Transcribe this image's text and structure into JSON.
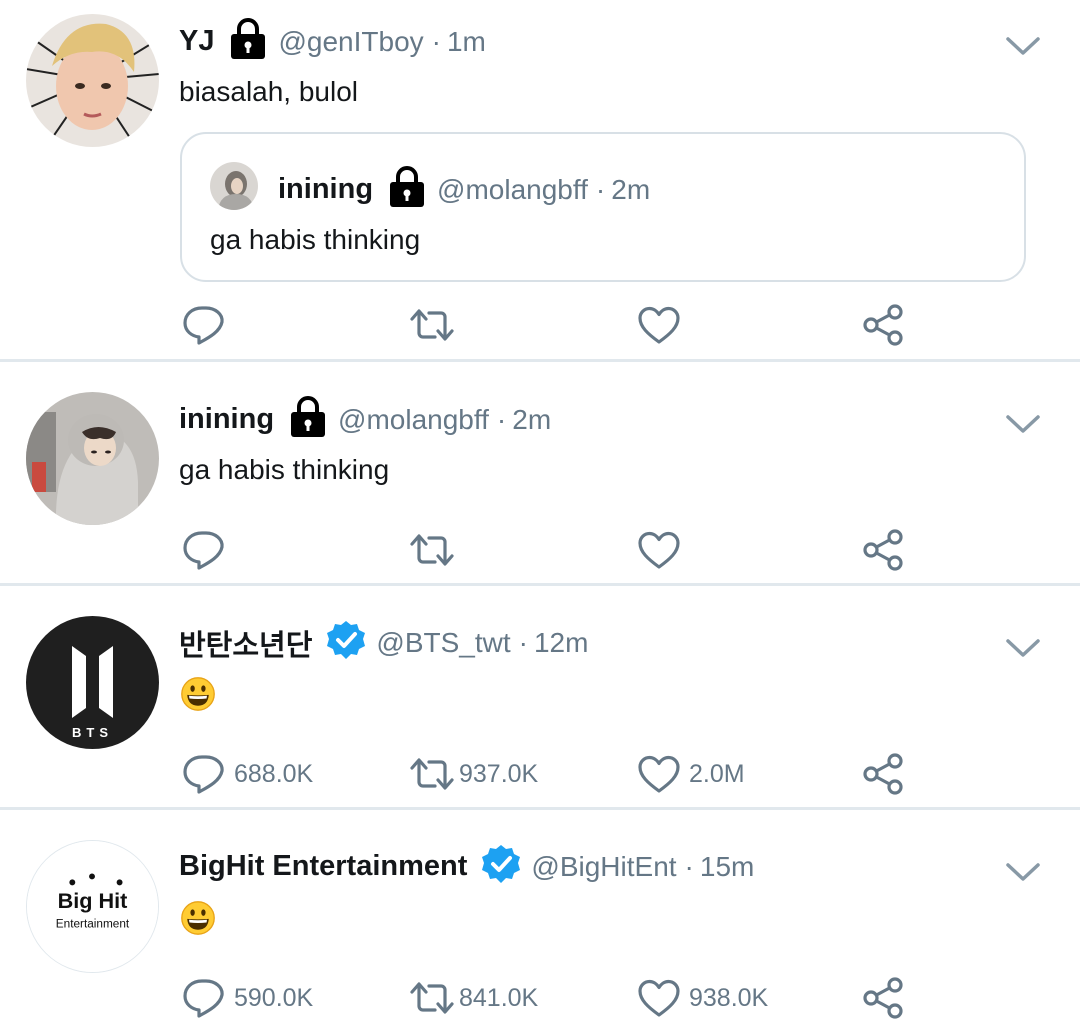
{
  "tweets": [
    {
      "name": "YJ",
      "handle": "@genITboy",
      "sep": "·",
      "time": "1m",
      "text": "biasalah, bulol",
      "quoted": {
        "name": "inining",
        "handle": "@molangbff",
        "sep": "·",
        "time": "2m",
        "text": "ga habis thinking"
      },
      "counts": {
        "reply": "",
        "retweet": "",
        "like": ""
      }
    },
    {
      "name": "inining",
      "handle": "@molangbff",
      "sep": "·",
      "time": "2m",
      "text": "ga habis thinking",
      "counts": {
        "reply": "",
        "retweet": "",
        "like": ""
      }
    },
    {
      "name": "반탄소년단",
      "handle": "@BTS_twt",
      "sep": "·",
      "time": "12m",
      "emoji": "grinning-face-emoji",
      "avatar_text": "BTS",
      "counts": {
        "reply": "688.0K",
        "retweet": "937.0K",
        "like": "2.0M"
      }
    },
    {
      "name": "BigHit Entertainment",
      "handle": "@BigHitEnt",
      "sep": "·",
      "time": "15m",
      "emoji": "grinning-face-emoji",
      "avatar_text": {
        "line1": "Big Hit",
        "line2": "Entertainment"
      },
      "counts": {
        "reply": "590.0K",
        "retweet": "841.0K",
        "like": "938.0K"
      }
    }
  ],
  "colors": {
    "text": "#14171a",
    "secondary": "#657786",
    "verified": "#1da1f2",
    "divider": "#e1e8ed",
    "emoji": "#ffcc33"
  },
  "icons": [
    "lock-icon",
    "verified-badge-icon",
    "chevron-down-icon",
    "reply-icon",
    "retweet-icon",
    "like-icon",
    "share-icon"
  ]
}
